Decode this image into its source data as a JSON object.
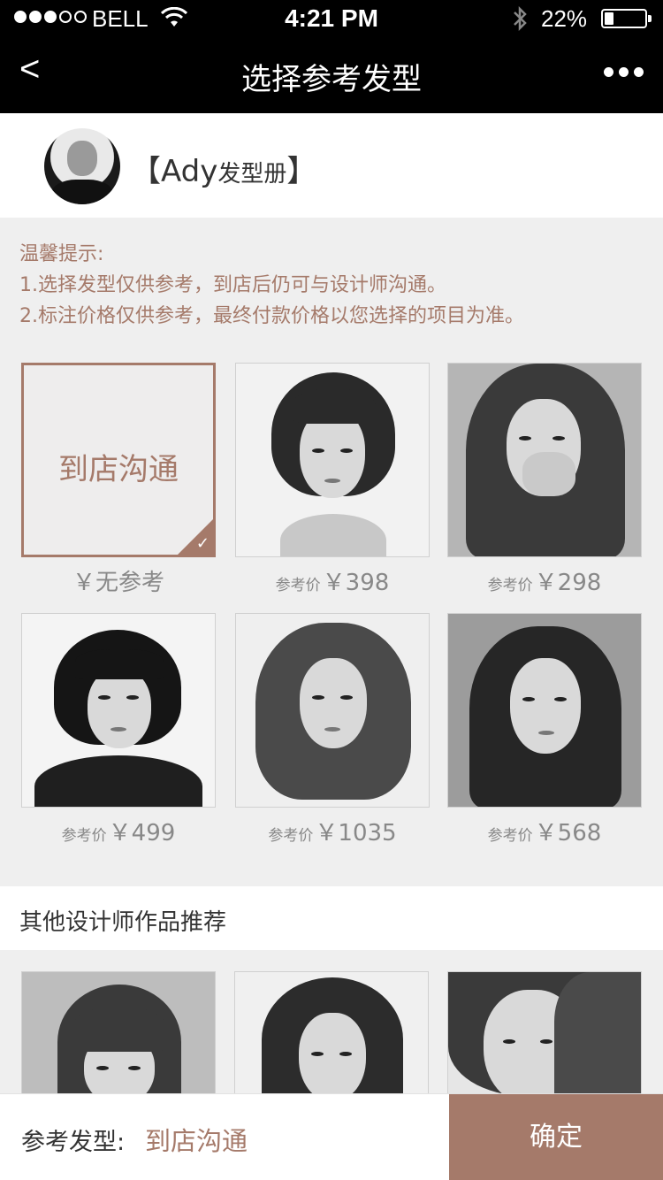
{
  "status": {
    "carrier": "BELL",
    "time": "4:21 PM",
    "battery": "22%",
    "battery_level": 0.22,
    "signal_bars": 3,
    "signal_total": 5
  },
  "nav": {
    "back": "<",
    "title": "选择参考发型",
    "more_icon": "more-dots-icon"
  },
  "designer": {
    "name_open": "【Ady",
    "name_rest": "发型册",
    "name_close": "】"
  },
  "tips": {
    "heading": "温馨提示:",
    "line1": "1.选择发型仅供参考，到店后仍可与设计师沟通。",
    "line2": "2.标注价格仅供参考，最终付款价格以您选择的项目为准。"
  },
  "options": [
    {
      "type": "consult",
      "label": "到店沟通",
      "price": "￥无参考",
      "selected": true
    },
    {
      "type": "photo",
      "price_label": "参考价",
      "price": "￥398"
    },
    {
      "type": "photo",
      "price_label": "参考价",
      "price": "￥298"
    },
    {
      "type": "photo",
      "price_label": "参考价",
      "price": "￥499"
    },
    {
      "type": "photo",
      "price_label": "参考价",
      "price": "￥1035"
    },
    {
      "type": "photo",
      "price_label": "参考价",
      "price": "￥568"
    }
  ],
  "recommend": {
    "title": "其他设计师作品推荐"
  },
  "bottom": {
    "label": "参考发型:",
    "value": "到店沟通",
    "confirm": "确定"
  },
  "colors": {
    "accent": "#a57a6a",
    "bar": "#000000",
    "background": "#efefef"
  }
}
